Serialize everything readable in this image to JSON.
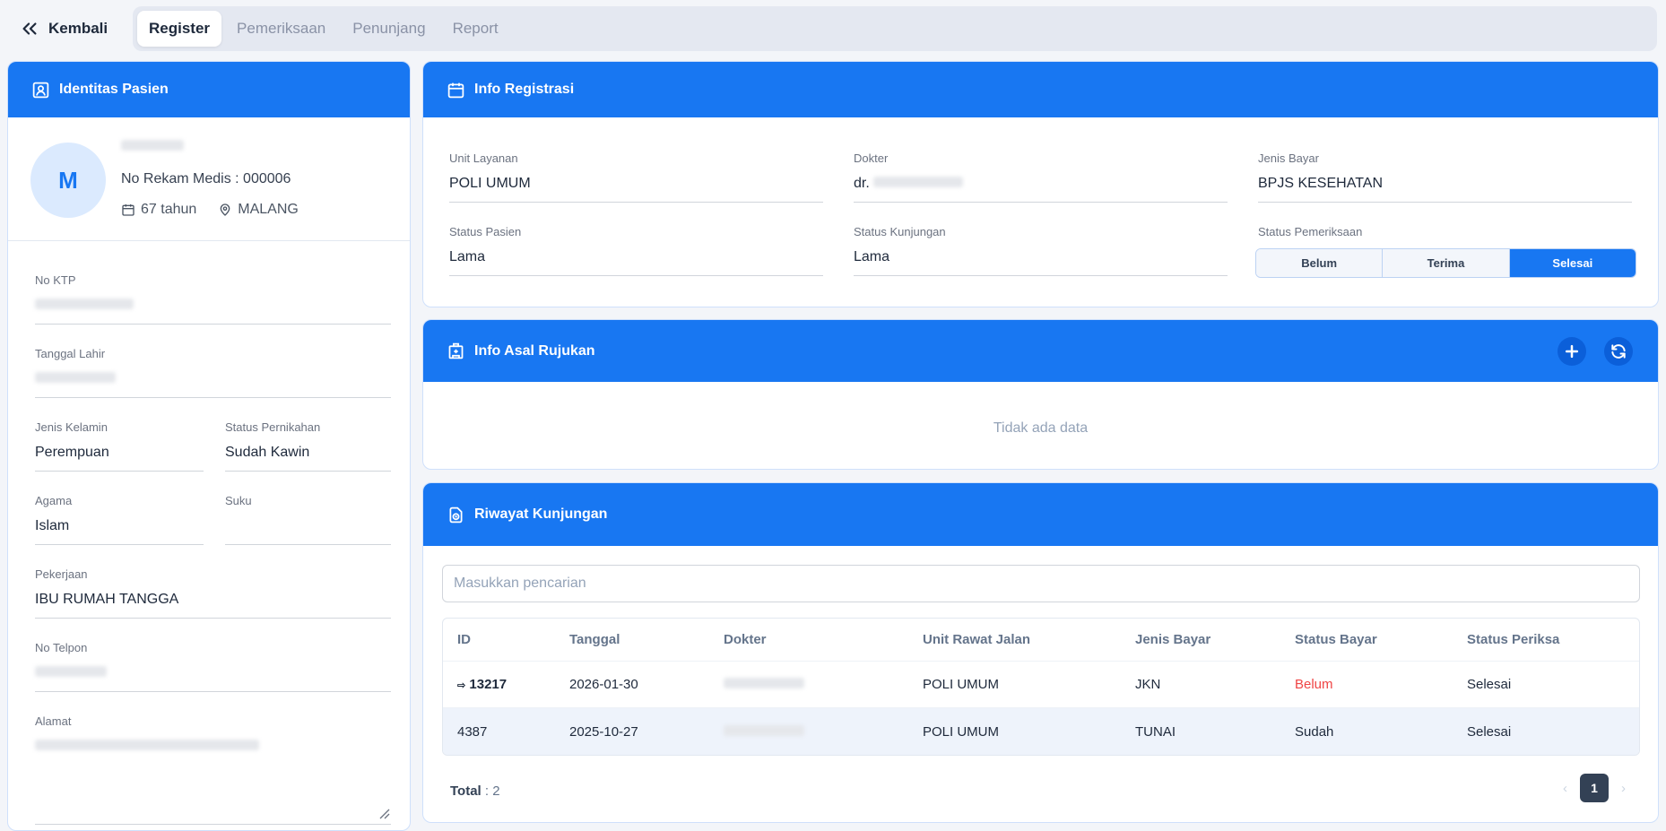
{
  "nav": {
    "back_label": "Kembali",
    "tabs": [
      {
        "label": "Register",
        "active": true
      },
      {
        "label": "Pemeriksaan",
        "active": false
      },
      {
        "label": "Penunjang",
        "active": false
      },
      {
        "label": "Report",
        "active": false
      }
    ]
  },
  "patient_card": {
    "title": "Identitas Pasien",
    "avatar_initial": "M",
    "rekam_medis": "No Rekam Medis : 000006",
    "age": "67 tahun",
    "city": "MALANG",
    "fields": {
      "no_ktp_label": "No KTP",
      "tanggal_lahir_label": "Tanggal Lahir",
      "jenis_kelamin_label": "Jenis Kelamin",
      "jenis_kelamin_value": "Perempuan",
      "status_pernikahan_label": "Status Pernikahan",
      "status_pernikahan_value": "Sudah Kawin",
      "agama_label": "Agama",
      "agama_value": "Islam",
      "suku_label": "Suku",
      "pekerjaan_label": "Pekerjaan",
      "pekerjaan_value": "IBU RUMAH TANGGA",
      "no_telepon_label": "No Telpon",
      "alamat_label": "Alamat"
    }
  },
  "registration": {
    "title": "Info Registrasi",
    "unit_layanan_label": "Unit Layanan",
    "unit_layanan_value": "POLI UMUM",
    "dokter_label": "Dokter",
    "dokter_value": "dr.",
    "jenis_bayar_label": "Jenis Bayar",
    "jenis_bayar_value": "BPJS KESEHATAN",
    "status_pasien_label": "Status Pasien",
    "status_pasien_value": "Lama",
    "status_kunjungan_label": "Status Kunjungan",
    "status_kunjungan_value": "Lama",
    "status_pemeriksaan_label": "Status Pemeriksaan",
    "status_options": [
      "Belum",
      "Terima",
      "Selesai"
    ],
    "status_selected": "Selesai"
  },
  "rujukan": {
    "title": "Info Asal Rujukan",
    "empty_text": "Tidak ada data"
  },
  "riwayat": {
    "title": "Riwayat Kunjungan",
    "search_placeholder": "Masukkan pencarian",
    "columns": [
      "ID",
      "Tanggal",
      "Dokter",
      "Unit Rawat Jalan",
      "Jenis Bayar",
      "Status Bayar",
      "Status Periksa"
    ],
    "rows": [
      {
        "id": "13217",
        "tanggal": "2026-01-30",
        "dokter": "",
        "unit": "POLI UMUM",
        "jenis_bayar": "JKN",
        "status_bayar": "Belum",
        "status_periksa": "Selesai"
      },
      {
        "id": "4387",
        "tanggal": "2025-10-27",
        "dokter": "",
        "unit": "POLI UMUM",
        "jenis_bayar": "TUNAI",
        "status_bayar": "Sudah",
        "status_periksa": "Selesai"
      }
    ],
    "total_label": "Total",
    "total_value": ": 2",
    "current_page": "1"
  },
  "colors": {
    "primary": "#1877f2",
    "danger": "#ef4444",
    "header_dark": "#334155"
  }
}
